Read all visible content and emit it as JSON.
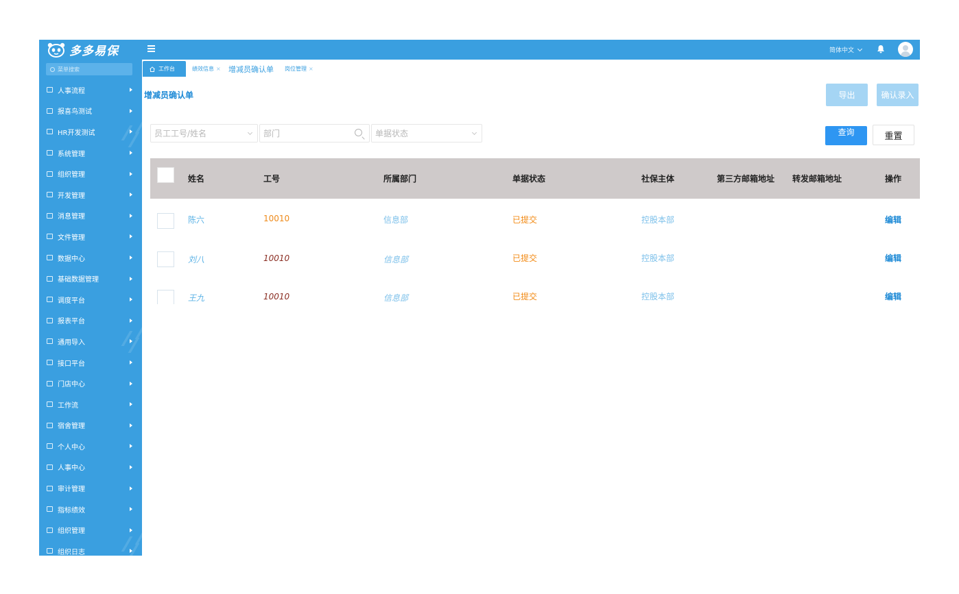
{
  "app": {
    "brand": "多多易保",
    "menu_search_placeholder": "菜单搜索",
    "language": "简体中文"
  },
  "sidebar": {
    "items": [
      {
        "label": "人事流程"
      },
      {
        "label": "报喜鸟测试"
      },
      {
        "label": "HR开发测试"
      },
      {
        "label": "系统管理"
      },
      {
        "label": "组织管理"
      },
      {
        "label": "开发管理"
      },
      {
        "label": "消息管理"
      },
      {
        "label": "文件管理"
      },
      {
        "label": "数据中心"
      },
      {
        "label": "基础数据管理"
      },
      {
        "label": "调度平台"
      },
      {
        "label": "报表平台"
      },
      {
        "label": "通用导入"
      },
      {
        "label": "接口平台"
      },
      {
        "label": "门店中心"
      },
      {
        "label": "工作流"
      },
      {
        "label": "宿舍管理"
      },
      {
        "label": "个人中心"
      },
      {
        "label": "人事中心"
      },
      {
        "label": "审计管理"
      },
      {
        "label": "指标绩效"
      },
      {
        "label": "组织管理"
      },
      {
        "label": "组织日志"
      }
    ]
  },
  "tabs": {
    "home": "工作台",
    "perf": "绩效信息",
    "confirm": "增减员确认单",
    "position": "岗位管理",
    "close": "×"
  },
  "page": {
    "title": "增减员确认单",
    "export_label": "导出",
    "confirm_entry_label": "确认录入"
  },
  "filters": {
    "employee_placeholder": "员工工号/姓名",
    "dept_placeholder": "部门",
    "status_placeholder": "单据状态",
    "query_label": "查询",
    "reset_label": "重置"
  },
  "table": {
    "headers": {
      "name": "姓名",
      "no": "工号",
      "dept": "所属部门",
      "status": "单据状态",
      "entity": "社保主体",
      "third_email": "第三方邮箱地址",
      "fwd_email": "转发邮箱地址",
      "op": "操作"
    },
    "rows": [
      {
        "name": "陈六",
        "no": "10010",
        "dept": "信息部",
        "status": "已提交",
        "entity": "控股本部",
        "op": "编辑"
      },
      {
        "name": "刘八",
        "no": "10010",
        "dept": "信息部",
        "status": "已提交",
        "entity": "控股本部",
        "op": "编辑"
      },
      {
        "name": "王九",
        "no": "10010",
        "dept": "信息部",
        "status": "已提交",
        "entity": "控股本部",
        "op": "编辑"
      }
    ]
  },
  "colors": {
    "primary": "#3a9fe0",
    "header_bg": "#cfcaca",
    "status_orange": "#f28a14"
  }
}
